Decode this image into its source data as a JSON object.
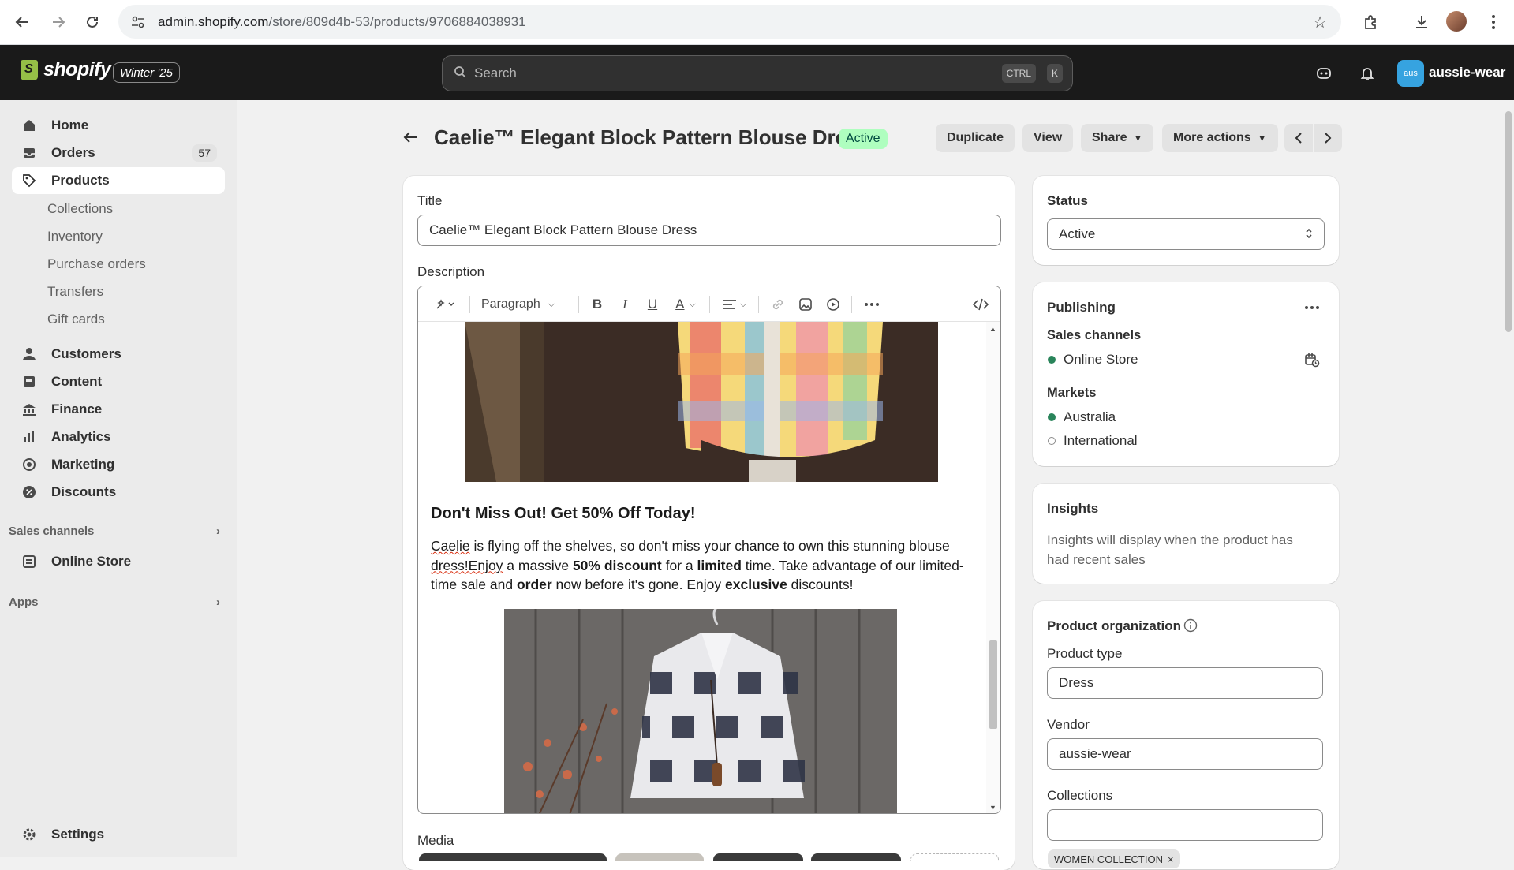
{
  "browser": {
    "url_host": "admin.shopify.com",
    "url_path": "/store/809d4b-53/products/9706884038931"
  },
  "topbar": {
    "brand": "shopify",
    "edition": "Winter '25",
    "search_placeholder": "Search",
    "shortcut_1": "CTRL",
    "shortcut_2": "K",
    "store_badge": "aus",
    "store_name": "aussie-wear"
  },
  "sidebar": {
    "home": "Home",
    "orders": "Orders",
    "orders_count": "57",
    "products": "Products",
    "sub": [
      "Collections",
      "Inventory",
      "Purchase orders",
      "Transfers",
      "Gift cards"
    ],
    "customers": "Customers",
    "content": "Content",
    "finance": "Finance",
    "analytics": "Analytics",
    "marketing": "Marketing",
    "discounts": "Discounts",
    "sales_channels": "Sales channels",
    "online_store": "Online Store",
    "apps": "Apps",
    "settings": "Settings"
  },
  "header": {
    "title": "Caelie™ Elegant Block Pattern Blouse Dress",
    "status": "Active",
    "duplicate": "Duplicate",
    "view": "View",
    "share": "Share",
    "more_actions": "More actions"
  },
  "product": {
    "title_label": "Title",
    "title_value": "Caelie™  Elegant Block Pattern Blouse Dress",
    "description_label": "Description",
    "toolbar_paragraph": "Paragraph",
    "content_heading": "Don't Miss Out! Get 50% Off Today!",
    "para": {
      "w1": "Caelie",
      "w2": " is flying off the shelves, so don't miss your chance to own this stunning blouse ",
      "w3": "dress!Enjoy",
      "w4": " a massive ",
      "b1": "50% discount",
      "w5": " for a ",
      "b2": "limited",
      "w6": " time.  Take advantage of our limited-time sale and ",
      "b3": "order",
      "w7": " now before it's gone. Enjoy  ",
      "b4": "exclusive",
      "w8": " discounts!"
    },
    "media_label": "Media"
  },
  "status_card": {
    "label": "Status",
    "value": "Active"
  },
  "publishing": {
    "label": "Publishing",
    "sales_channels": "Sales channels",
    "online_store": "Online Store",
    "markets": "Markets",
    "australia": "Australia",
    "international": "International"
  },
  "insights": {
    "label": "Insights",
    "text": "Insights will display when the product has had recent sales"
  },
  "organization": {
    "label": "Product organization",
    "type_label": "Product type",
    "type_value": "Dress",
    "vendor_label": "Vendor",
    "vendor_value": "aussie-wear",
    "collections_label": "Collections",
    "collections_value": "",
    "tag": "WOMEN COLLECTION"
  },
  "colors": {
    "accent_active": "#affebf",
    "topbar": "#1a1a1a",
    "published_dot": "#29845a"
  }
}
